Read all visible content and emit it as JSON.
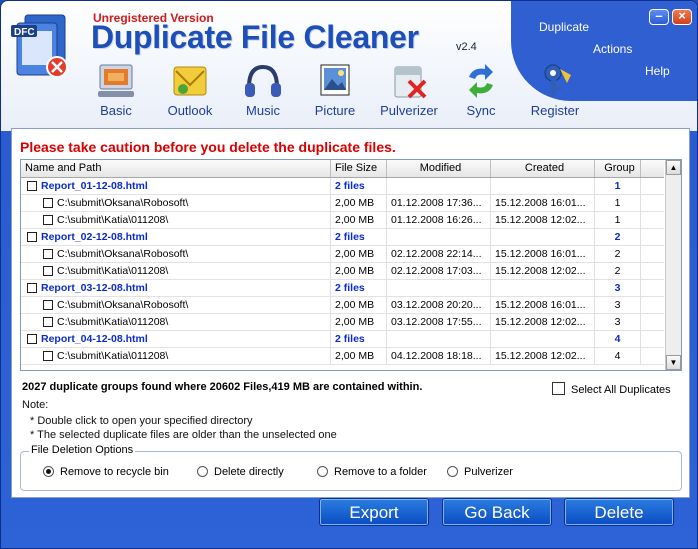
{
  "header": {
    "unregistered": "Unregistered Version",
    "title": "Duplicate File Cleaner",
    "version": "v2.4",
    "logo_text": "DFC",
    "menu": [
      "Duplicate",
      "Actions",
      "Help"
    ],
    "window_controls": [
      "minimize",
      "close"
    ]
  },
  "toolbar": {
    "items": [
      {
        "label": "Basic",
        "icon": "basic-icon"
      },
      {
        "label": "Outlook",
        "icon": "outlook-icon"
      },
      {
        "label": "Music",
        "icon": "headphones-icon"
      },
      {
        "label": "Picture",
        "icon": "picture-icon"
      },
      {
        "label": "Pulverizer",
        "icon": "pulverizer-icon"
      },
      {
        "label": "Sync",
        "icon": "sync-icon"
      },
      {
        "label": "Register",
        "icon": "key-icon"
      }
    ]
  },
  "caution": "Please take caution before you delete the duplicate files.",
  "table": {
    "columns": [
      "Name and Path",
      "File Size",
      "Modified",
      "Created",
      "Group"
    ],
    "rows": [
      {
        "type": "group",
        "name": "Report_01-12-08.html",
        "size": "2  files",
        "modified": "",
        "created": "",
        "group": "1"
      },
      {
        "type": "file",
        "name": "C:\\submit\\Oksana\\Robosoft\\",
        "size": "2,00 MB",
        "modified": "01.12.2008 17:36...",
        "created": "15.12.2008 16:01...",
        "group": "1"
      },
      {
        "type": "file",
        "name": "C:\\submit\\Katia\\011208\\",
        "size": "2,00 MB",
        "modified": "01.12.2008 16:26...",
        "created": "15.12.2008 12:02...",
        "group": "1"
      },
      {
        "type": "group",
        "name": "Report_02-12-08.html",
        "size": "2  files",
        "modified": "",
        "created": "",
        "group": "2"
      },
      {
        "type": "file",
        "name": "C:\\submit\\Oksana\\Robosoft\\",
        "size": "2,00 MB",
        "modified": "02.12.2008 22:14...",
        "created": "15.12.2008 16:01...",
        "group": "2"
      },
      {
        "type": "file",
        "name": "C:\\submit\\Katia\\011208\\",
        "size": "2,00 MB",
        "modified": "02.12.2008 17:03...",
        "created": "15.12.2008 12:02...",
        "group": "2"
      },
      {
        "type": "group",
        "name": "Report_03-12-08.html",
        "size": "2  files",
        "modified": "",
        "created": "",
        "group": "3"
      },
      {
        "type": "file",
        "name": "C:\\submit\\Oksana\\Robosoft\\",
        "size": "2,00 MB",
        "modified": "03.12.2008 20:20...",
        "created": "15.12.2008 16:01...",
        "group": "3"
      },
      {
        "type": "file",
        "name": "C:\\submit\\Katia\\011208\\",
        "size": "2,00 MB",
        "modified": "03.12.2008 17:55...",
        "created": "15.12.2008 12:02...",
        "group": "3"
      },
      {
        "type": "group",
        "name": "Report_04-12-08.html",
        "size": "2  files",
        "modified": "",
        "created": "",
        "group": "4"
      },
      {
        "type": "file",
        "name": "C:\\submit\\Katia\\011208\\",
        "size": "2,00 MB",
        "modified": "04.12.2008 18:18...",
        "created": "15.12.2008 12:02...",
        "group": "4"
      }
    ]
  },
  "summary": "2027 duplicate groups found where 20602 Files,419 MB are contained within.",
  "select_all": "Select All Duplicates",
  "notes": {
    "title": "Note:",
    "lines": [
      "* Double click to open  your specified directory",
      "* The selected duplicate files are older than the unselected one"
    ]
  },
  "deletion_options": {
    "legend": "File Deletion Options",
    "options": [
      "Remove to recycle bin",
      "Delete directly",
      "Remove to a folder",
      "Pulverizer"
    ],
    "selected": "Remove to recycle bin"
  },
  "buttons": {
    "export": "Export",
    "go_back": "Go Back",
    "delete": "Delete"
  }
}
